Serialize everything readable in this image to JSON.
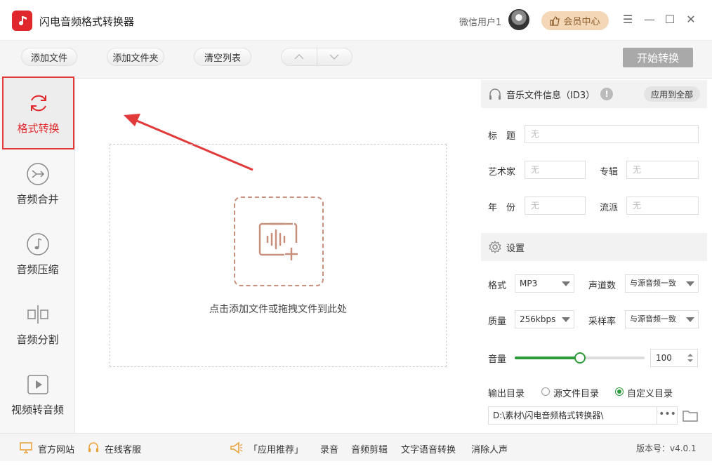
{
  "app": {
    "title": "闪电音频格式转换器",
    "user_name": "微信用户1",
    "vip_label": "会员中心"
  },
  "toolbar": {
    "add_file": "添加文件",
    "add_folder": "添加文件夹",
    "clear_list": "清空列表",
    "start": "开始转换"
  },
  "sidebar": {
    "items": [
      {
        "label": "格式转换",
        "icon": "refresh-icon",
        "active": true
      },
      {
        "label": "音频合并",
        "icon": "merge-icon",
        "active": false
      },
      {
        "label": "音频压缩",
        "icon": "music-note-icon",
        "active": false
      },
      {
        "label": "音频分割",
        "icon": "split-icon",
        "active": false
      },
      {
        "label": "视频转音频",
        "icon": "video-play-icon",
        "active": false
      }
    ]
  },
  "dropzone": {
    "hint": "点击添加文件或拖拽文件到此处"
  },
  "id3": {
    "header": "音乐文件信息（ID3）",
    "apply_all": "应用到全部",
    "title_label": "标　题",
    "artist_label": "艺术家",
    "album_label": "专辑",
    "year_label": "年　份",
    "genre_label": "流派",
    "placeholder": "无"
  },
  "settings": {
    "header": "设置",
    "format_label": "格式",
    "format_value": "MP3",
    "channels_label": "声道数",
    "channels_value": "与源音频一致",
    "quality_label": "质量",
    "quality_value": "256kbps",
    "samplerate_label": "采样率",
    "samplerate_value": "与源音频一致",
    "volume_label": "音量",
    "volume_value": "100",
    "volume_fraction": 0.5,
    "output_label": "输出目录",
    "opt_source": "源文件目录",
    "opt_custom": "自定义目录",
    "output_path": "D:\\素材\\闪电音频格式转换器\\",
    "dots": "•••"
  },
  "status": {
    "website": "官方网站",
    "support": "在线客服",
    "recommend": "「应用推荐」",
    "record": "录音",
    "edit": "音频剪辑",
    "tts": "文字语音转换",
    "vocal": "消除人声",
    "version": "版本号：v4.0.1"
  },
  "colors": {
    "accent_red": "#e0272c",
    "green": "#2e9b3a",
    "vip_bg": "#f3d7b6"
  }
}
